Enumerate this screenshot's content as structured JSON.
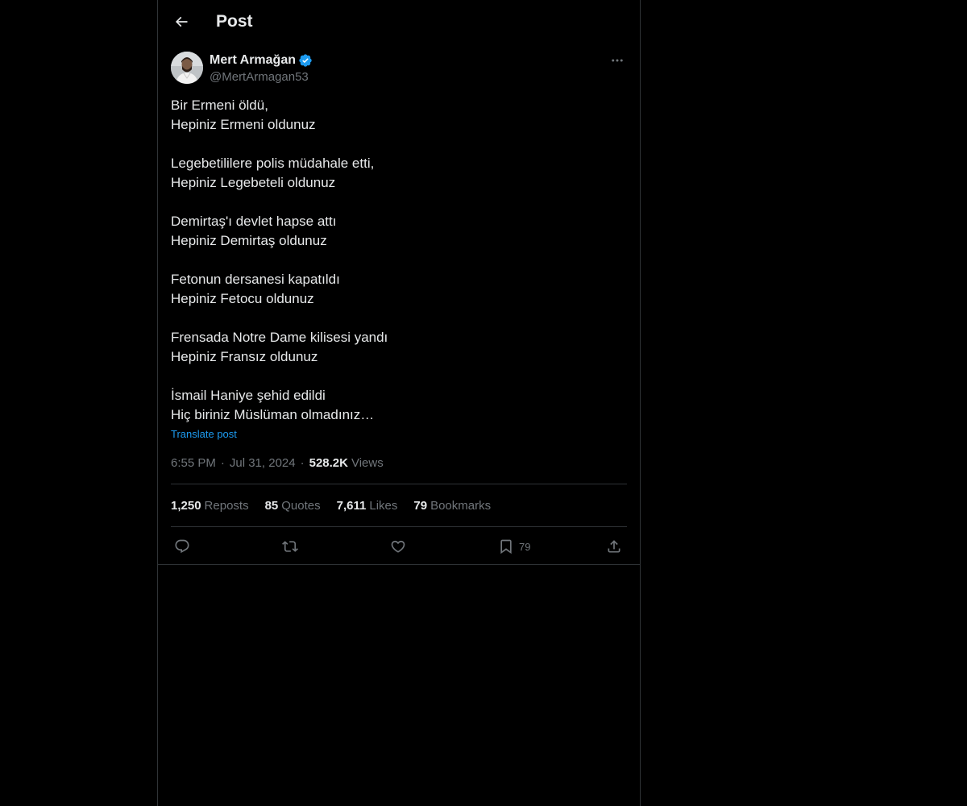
{
  "header": {
    "title": "Post"
  },
  "post": {
    "author": {
      "display_name": "Mert Armağan",
      "handle": "@MertArmagan53",
      "verified": true
    },
    "text": "Bir Ermeni öldü,\nHepiniz Ermeni oldunuz\n\nLegebetililere polis müdahale etti,\nHepiniz Legebeteli oldunuz\n\nDemirtaş'ı devlet hapse attı\nHepiniz Demirtaş oldunuz\n\nFetonun dersanesi kapatıldı\nHepiniz Fetocu oldunuz\n\nFrensada Notre Dame kilisesi yandı\nHepiniz Fransız oldunuz\n\nİsmail Haniye şehid edildi\nHiç biriniz Müslüman olmadınız…",
    "translate_label": "Translate post",
    "time": "6:55 PM",
    "date": "Jul 31, 2024",
    "separator": "·",
    "views_count": "528.2K",
    "views_label": "Views"
  },
  "stats": {
    "reposts_count": "1,250",
    "reposts_label": "Reposts",
    "quotes_count": "85",
    "quotes_label": "Quotes",
    "likes_count": "7,611",
    "likes_label": "Likes",
    "bookmarks_count": "79",
    "bookmarks_label": "Bookmarks"
  },
  "actions": {
    "bookmark_count": "79"
  },
  "icons": {
    "back": "arrow-left-icon",
    "verified": "verified-badge-icon",
    "more": "more-horizontal-icon",
    "reply": "reply-icon",
    "repost": "repost-icon",
    "like": "heart-icon",
    "bookmark": "bookmark-icon",
    "share": "share-icon"
  },
  "colors": {
    "background": "#000000",
    "text_primary": "#e7e9ea",
    "text_secondary": "#71767b",
    "accent": "#1d9bf0",
    "border": "#2f3336"
  }
}
